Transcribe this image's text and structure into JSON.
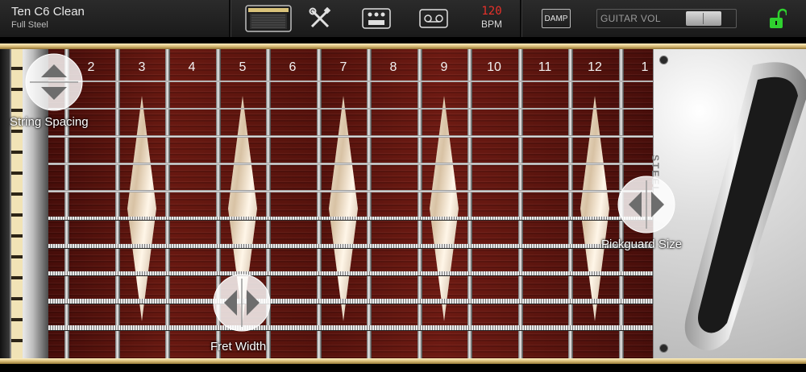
{
  "preset": {
    "name": "Ten C6 Clean",
    "subtitle": "Full Steel"
  },
  "toolbar": {
    "icons": [
      "amp-icon",
      "tools-icon",
      "pedals-icon",
      "tape-icon"
    ],
    "bpm_value": "120",
    "bpm_label": "BPM",
    "damp_label": "DAMP",
    "volume_label": "GUITAR VOL",
    "lock_color": "#2fd12f"
  },
  "neck": {
    "fret_numbers": [
      "2",
      "3",
      "4",
      "5",
      "6",
      "7",
      "8",
      "9",
      "10",
      "11",
      "12",
      "1"
    ],
    "pickguard_text": "STEEL"
  },
  "controls": {
    "string_spacing_label": "String Spacing",
    "fret_width_label": "Fret Width",
    "pickguard_size_label": "Pickguard Size"
  },
  "colors": {
    "wood": "#6e1a12",
    "gold": "#cfb06a",
    "bpm": "#e8312a"
  }
}
